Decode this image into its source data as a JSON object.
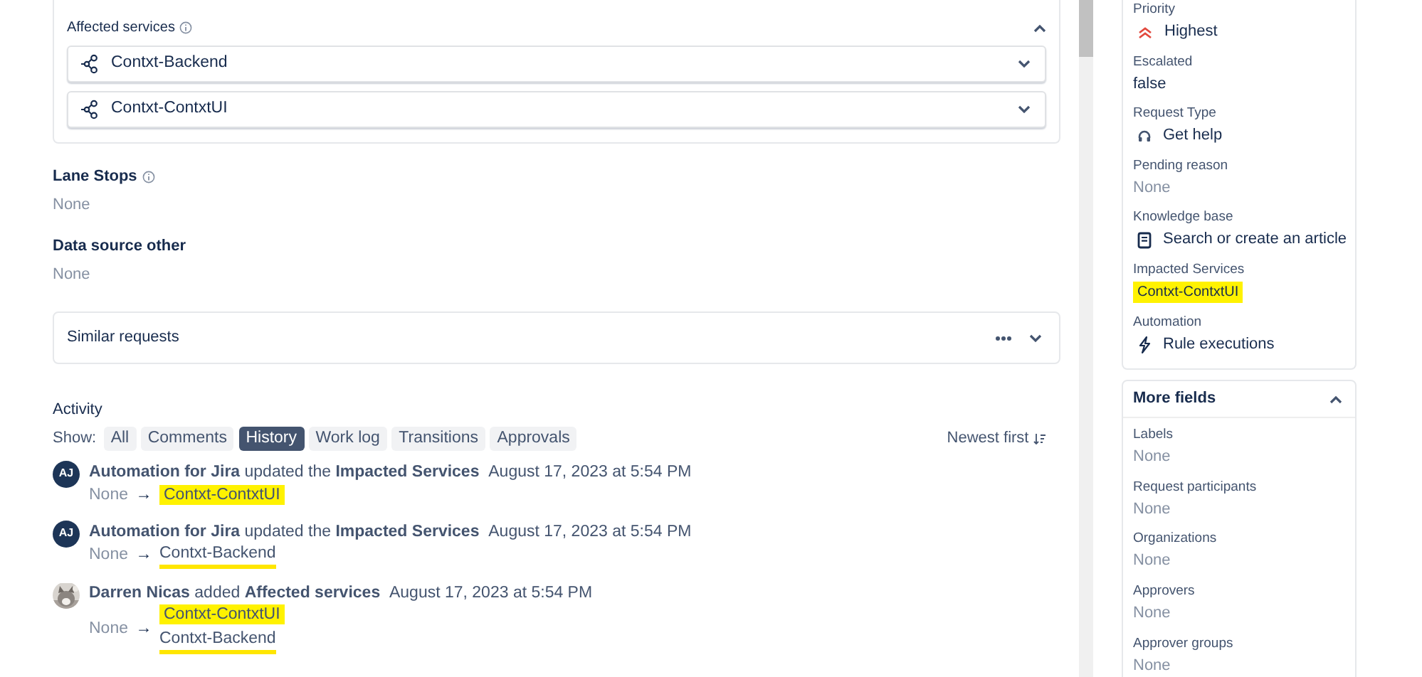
{
  "affected_services": {
    "label": "Affected services",
    "expanded": true,
    "items": [
      {
        "name": "Contxt-Backend",
        "expanded": false
      },
      {
        "name": "Contxt-ContxtUI",
        "expanded": false
      }
    ]
  },
  "fields": [
    {
      "label": "Lane Stops",
      "info": true,
      "value": "None"
    },
    {
      "label": "Data source other",
      "info": false,
      "value": "None"
    }
  ],
  "similar_requests": {
    "title": "Similar requests",
    "expanded": false
  },
  "activity": {
    "title": "Activity",
    "show_label": "Show:",
    "filters": [
      {
        "label": "All",
        "selected": false
      },
      {
        "label": "Comments",
        "selected": false
      },
      {
        "label": "History",
        "selected": true
      },
      {
        "label": "Work log",
        "selected": false
      },
      {
        "label": "Transitions",
        "selected": false
      },
      {
        "label": "Approvals",
        "selected": false
      }
    ],
    "sort": "Newest first",
    "entries": [
      {
        "avatar": {
          "kind": "initials",
          "text": "AJ"
        },
        "actor": "Automation for Jira",
        "action": "updated the",
        "field": "Impacted Services",
        "time": "August 17, 2023 at 5:54 PM",
        "from": "None",
        "arrow": "→",
        "to": [
          {
            "text": "Contxt-ContxtUI",
            "highlighted": true,
            "underlined": false
          }
        ]
      },
      {
        "avatar": {
          "kind": "initials",
          "text": "AJ"
        },
        "actor": "Automation for Jira",
        "action": "updated the",
        "field": "Impacted Services",
        "time": "August 17, 2023 at 5:54 PM",
        "from": "None",
        "arrow": "→",
        "to": [
          {
            "text": "Contxt-Backend",
            "highlighted": false,
            "underlined": true
          }
        ]
      },
      {
        "avatar": {
          "kind": "picture"
        },
        "actor": "Darren Nicas",
        "action": "added",
        "field": "Affected services",
        "time": "August 17, 2023 at 5:54 PM",
        "from": "None",
        "arrow": "→",
        "to": [
          {
            "text": "Contxt-ContxtUI",
            "highlighted": true,
            "underlined": false
          },
          {
            "text": "Contxt-Backend",
            "highlighted": false,
            "underlined": true
          }
        ]
      }
    ]
  },
  "sidebar": {
    "fields": [
      {
        "label": "Priority",
        "value": "Highest",
        "kind": "priority"
      },
      {
        "label": "Escalated",
        "value": "false",
        "kind": "text"
      },
      {
        "label": "Request Type",
        "value": "Get help",
        "kind": "requesttype"
      },
      {
        "label": "Pending reason",
        "value": "None",
        "kind": "empty"
      },
      {
        "label": "Knowledge base",
        "value": "Search or create an article",
        "kind": "article"
      },
      {
        "label": "Impacted Services",
        "value": "Contxt-ContxtUI",
        "kind": "chip",
        "highlighted": true
      },
      {
        "label": "Automation",
        "value": "Rule executions",
        "kind": "automation"
      }
    ],
    "more_fields": {
      "title": "More fields",
      "expanded": true,
      "fields": [
        {
          "label": "Labels",
          "value": "None",
          "kind": "empty"
        },
        {
          "label": "Request participants",
          "value": "None",
          "kind": "empty"
        },
        {
          "label": "Organizations",
          "value": "None",
          "kind": "empty"
        },
        {
          "label": "Approvers",
          "value": "None",
          "kind": "empty"
        },
        {
          "label": "Approver groups",
          "value": "None",
          "kind": "empty"
        }
      ]
    }
  }
}
